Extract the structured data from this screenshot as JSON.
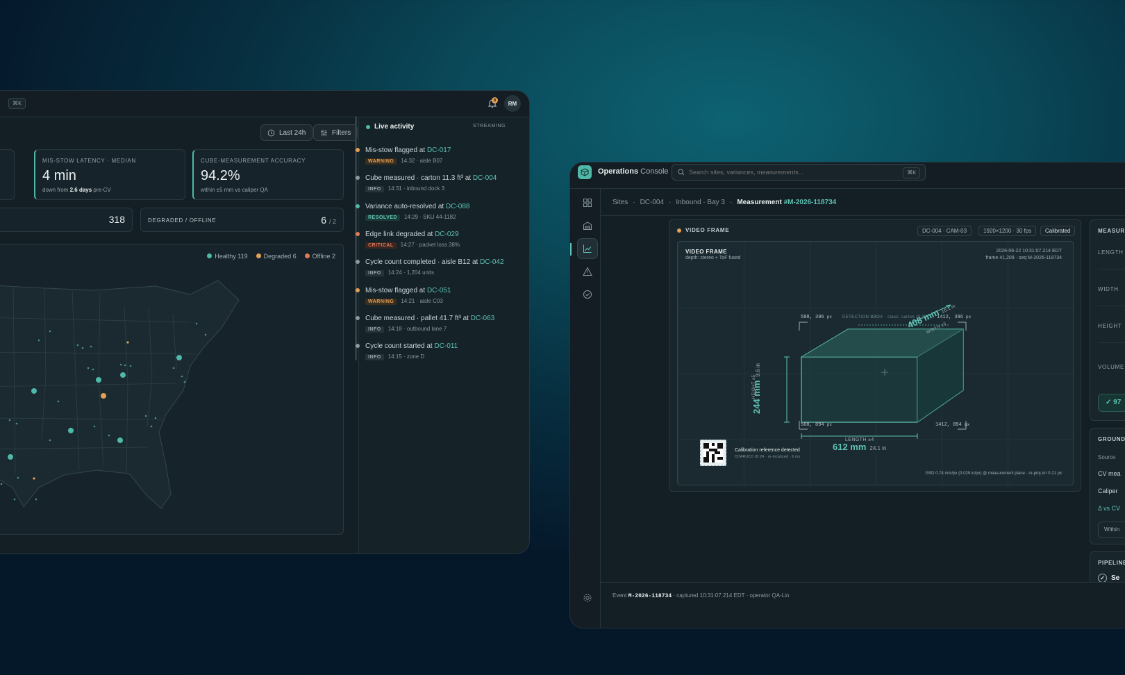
{
  "dashboard": {
    "search_shortcut": "⌘K",
    "notifications_count": "6",
    "avatar": "RM",
    "range_button": "Last 24h",
    "filters_button": "Filters",
    "kpis": [
      {
        "label": "MIS-STOW LATENCY · MEDIAN",
        "value": "4 min",
        "sub_prefix": "down from",
        "sub_bold": "2.6 days",
        "sub_suffix": "pre-CV"
      },
      {
        "label": "CUBE-MEASUREMENT ACCURACY",
        "value": "94.2%",
        "sub": "within ±5 mm vs caliper QA"
      }
    ],
    "partial_stat_value": "318",
    "degraded_label": "DEGRADED / OFFLINE",
    "degraded_value": "6",
    "degraded_total": "/ 2",
    "legend": [
      {
        "label": "Healthy 119",
        "color": "#4fb8a8"
      },
      {
        "label": "Degraded 6",
        "color": "#e4a055"
      },
      {
        "label": "Offline 2",
        "color": "#e07a5a"
      }
    ]
  },
  "activity": {
    "title": "Live activity",
    "status": "STREAMING",
    "items": [
      {
        "color": "#e4a055",
        "text": "Mis-stow flagged at ",
        "link": "DC-017",
        "badge": "WARNING",
        "badge_class": "bw",
        "meta": "14:32 · aisle B07"
      },
      {
        "color": "#8a9a9e",
        "text": "Cube measured · carton 11.3 ft³ at ",
        "link": "DC-004",
        "badge": "INFO",
        "badge_class": "bi",
        "meta": "14:31 · inbound dock 3"
      },
      {
        "color": "#4fb8a8",
        "text": "Variance auto-resolved at ",
        "link": "DC-088",
        "badge": "RESOLVED",
        "badge_class": "br",
        "meta": "14:29 · SKU 44-1182"
      },
      {
        "color": "#e07a5a",
        "text": "Edge link degraded at ",
        "link": "DC-029",
        "badge": "CRITICAL",
        "badge_class": "bc",
        "meta": "14:27 · packet loss 38%"
      },
      {
        "color": "#8a9a9e",
        "text": "Cycle count completed · aisle B12 at ",
        "link": "DC-042",
        "badge": "INFO",
        "badge_class": "bi",
        "meta": "14:24 · 1,204 units"
      },
      {
        "color": "#e4a055",
        "text": "Mis-stow flagged at ",
        "link": "DC-051",
        "badge": "WARNING",
        "badge_class": "bw",
        "meta": "14:21 · aisle C03"
      },
      {
        "color": "#8a9a9e",
        "text": "Cube measured · pallet 41.7 ft³ at ",
        "link": "DC-063",
        "badge": "INFO",
        "badge_class": "bi",
        "meta": "14:18 · outbound lane 7"
      },
      {
        "color": "#8a9a9e",
        "text": "Cycle count started at ",
        "link": "DC-011",
        "badge": "INFO",
        "badge_class": "bi",
        "meta": "14:15 · zone D"
      }
    ]
  },
  "console": {
    "app_bold": "Operations",
    "app_light": "Console",
    "search_placeholder": "Search sites, variances, measurements...",
    "search_shortcut": "⌘K",
    "breadcrumb": [
      "Sites",
      "DC-004",
      "Inbound · Bay 3"
    ],
    "crumb_current": "Measurement",
    "crumb_id": "#M-2026-118734",
    "frame_label": "VIDEO FRAME",
    "frame_tags": [
      "DC-004 · CAM-03",
      "1920×1200 · 30 fps",
      "Calibrated"
    ],
    "vf_title": "VIDEO FRAME",
    "vf_depth": "depth: stereo + ToF fused",
    "vf_timestamp": "2026-06-22 10:31:07.214 EDT",
    "vf_frame": "frame 41,209 · seq M-2026-118734",
    "detection": "DETECTION BBOX · class: carton (0.98)",
    "corners": [
      "588, 396",
      "1412, 396",
      "588, 894",
      "1412, 894"
    ],
    "corner_unit": "px",
    "length_label": "LENGTH ±4",
    "length_mm": "612 mm",
    "length_in": "24.1 in",
    "height_label": "HEIGHT ±5",
    "height_mm": "244 mm",
    "height_in": "9.6 in",
    "width_mm": "408 mm",
    "width_in": "16.1 in",
    "width_label": "WIDTH ±5",
    "calib_title": "Calibration reference detected",
    "calib_sub": "CHARUCO ID 24 · re-localized · 6 ms",
    "gsd": "GSD 0.74 mm/px (0.029 in/px) @ measurement plane · re-proj err 0.21 px",
    "right_panel": {
      "title": "MEASUR",
      "rows": [
        "LENGTH",
        "WIDTH",
        "HEIGHT",
        "VOLUME"
      ],
      "check": "97"
    },
    "ground_panel": {
      "title": "GROUND",
      "source": "Source",
      "rows": [
        "CV mea",
        "Caliper",
        "Δ vs CV"
      ],
      "within": "Within"
    },
    "pipeline": {
      "title": "PIPELINE",
      "item": "Se"
    },
    "footer": {
      "label": "Event",
      "id": "M-2026-118734",
      "rest": "· captured 10:31:07.214 EDT · operator QA-Lin"
    }
  },
  "colors": {
    "accent": "#5fc2b5",
    "warning": "#e4a055",
    "critical": "#e07a5a",
    "panel": "#141f25"
  }
}
